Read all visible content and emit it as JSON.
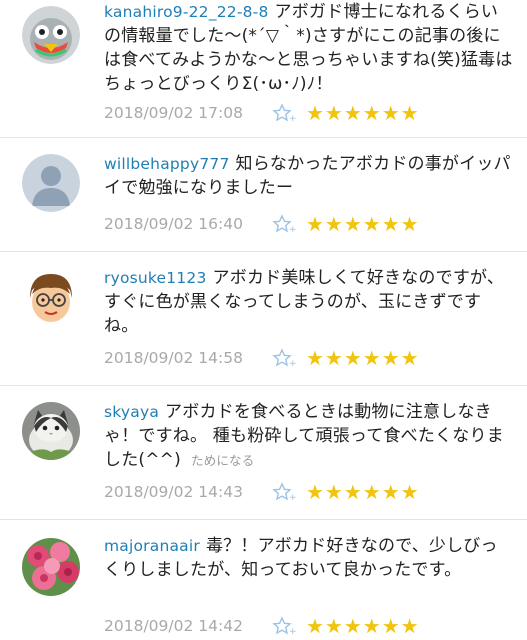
{
  "comments": [
    {
      "user": "kanahiro9-22_22-8-8",
      "text": "アボガド博士になれるくらいの情報量でした〜(*´▽｀*)さすがにこの記事の後には食べてみようかな〜と思っちゃいますね(笑)猛毒はちょっとびっくりΣ(･ω･ﾉ)ﾉ！",
      "extra": "",
      "date": "2018/09/02 17:08",
      "stars": "★★★★★★",
      "avatar_icon": "robot-avatar-icon"
    },
    {
      "user": "willbehappy777",
      "text": "知らなかったアボカドの事がイッパイで勉強になりましたー",
      "extra": "",
      "date": "2018/09/02 16:40",
      "stars": "★★★★★★",
      "avatar_icon": "default-person-avatar-icon"
    },
    {
      "user": "ryosuke1123",
      "text": "アボカド美味しくて好きなのですが、すぐに色が黒くなってしまうのが、玉にきずですね。",
      "extra": "",
      "date": "2018/09/02 14:58",
      "stars": "★★★★★★",
      "avatar_icon": "glasses-boy-avatar-icon"
    },
    {
      "user": "skyaya",
      "text": "アボカドを食べるときは動物に注意しなきゃ！ですね。 種も粉砕して頑張って食べたくなりました(^^)",
      "extra": "ためになる",
      "date": "2018/09/02 14:43",
      "stars": "★★★★★★",
      "avatar_icon": "cat-photo-avatar-icon"
    },
    {
      "user": "majoranaair",
      "text": "毒？！アボカド好きなので、少しびっくりしましたが、知っておいて良かったです。",
      "extra": "",
      "date": "2018/09/02 14:42",
      "stars": "★★★★★★",
      "avatar_icon": "flowers-photo-avatar-icon"
    }
  ],
  "colors": {
    "username": "#1f7fb5",
    "date": "#a9a9a9",
    "star": "#f1c40f",
    "favorite_icon": "#9cc3e6"
  }
}
